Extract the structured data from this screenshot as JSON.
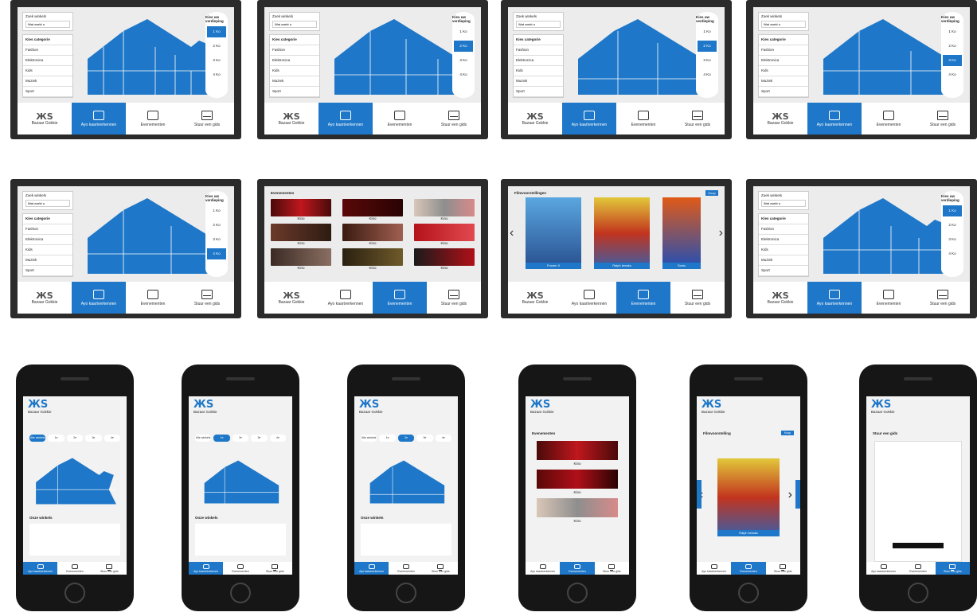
{
  "nav": {
    "brand": "Bazaar Gokkie",
    "items": [
      "Ayo kaartverkennen",
      "Evenementen",
      "Stuur een gids"
    ]
  },
  "floors": {
    "header": "Kies uw verdieping",
    "labels": [
      "1 Ko",
      "2 Ko",
      "3 Ko",
      "4 Ko"
    ]
  },
  "tablet_top": {
    "search_label": "Zoek winkels",
    "placeholder": "Wat zoekt u",
    "list_header": "Kies categorie",
    "list_items": [
      "Fashion",
      "Elektronica",
      "Kids",
      "Muziek",
      "Sport"
    ]
  },
  "events": {
    "title": "Evenementen",
    "captions": [
      "Kino",
      "Kino",
      "Kino",
      "Kino",
      "Kino",
      "Kino",
      "Kino",
      "Kino",
      "Kino"
    ]
  },
  "movies": {
    "title": "Filmvoorstellingen",
    "buy": "Koop",
    "posters": [
      "Frozen II",
      "Ralph breaks",
      "Sonic"
    ]
  },
  "phone": {
    "tabs": [
      "Alle winkels",
      "1e",
      "2e",
      "3e",
      "4e"
    ],
    "store_title": "Onze winkels",
    "movie_title": "Filmvoorstelling",
    "contact_title": "Stuur een gids",
    "events_title": "Evenementen",
    "event_captions": [
      "Kino",
      "Kino",
      "Kino"
    ]
  },
  "colors": {
    "accent": "#1e77c8",
    "frame": "#2b2b2b"
  }
}
